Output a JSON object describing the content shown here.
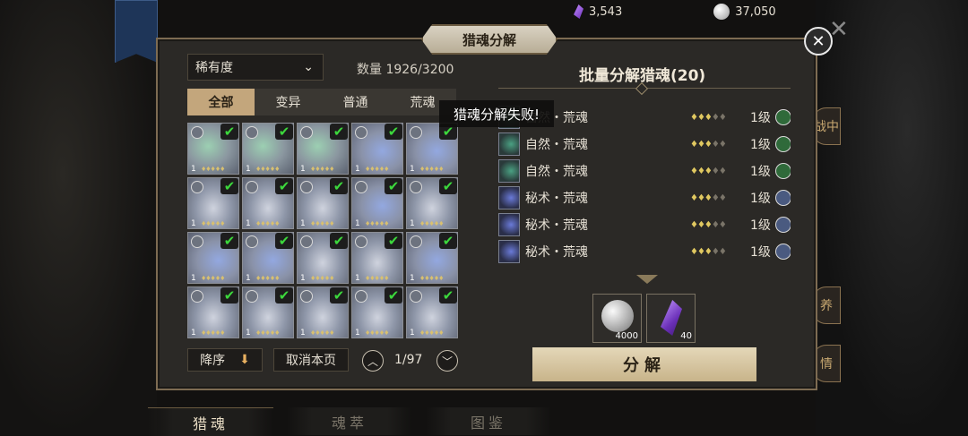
{
  "topbar": {
    "crystal_count": "3,543",
    "coin_count": "37,050",
    "crystal_icon": "purple-crystal-icon",
    "coin_icon": "silver-coin-icon"
  },
  "panel": {
    "title": "猎魂分解",
    "close": "✕"
  },
  "filter": {
    "rarity_label": "稀有度",
    "count_text": "数量 1926/3200"
  },
  "tabs": [
    {
      "label": "全部",
      "active": true
    },
    {
      "label": "变异",
      "active": false
    },
    {
      "label": "普通",
      "active": false
    },
    {
      "label": "荒魂",
      "active": false
    }
  ],
  "grid": {
    "cells": [
      {
        "level": "1",
        "stars": "♦♦♦♦♦",
        "style": "green"
      },
      {
        "level": "1",
        "stars": "♦♦♦♦♦",
        "style": "green"
      },
      {
        "level": "1",
        "stars": "♦♦♦♦♦",
        "style": "green"
      },
      {
        "level": "1",
        "stars": "♦♦♦♦♦",
        "style": "blue"
      },
      {
        "level": "1",
        "stars": "♦♦♦♦♦",
        "style": "blue"
      },
      {
        "level": "1",
        "stars": "♦♦♦♦♦",
        "style": "plain"
      },
      {
        "level": "1",
        "stars": "♦♦♦♦♦",
        "style": "plain"
      },
      {
        "level": "1",
        "stars": "♦♦♦♦♦",
        "style": "plain"
      },
      {
        "level": "1",
        "stars": "♦♦♦♦♦",
        "style": "blue"
      },
      {
        "level": "1",
        "stars": "♦♦♦♦♦",
        "style": "plain"
      },
      {
        "level": "1",
        "stars": "♦♦♦♦♦",
        "style": "blue"
      },
      {
        "level": "1",
        "stars": "♦♦♦♦♦",
        "style": "blue"
      },
      {
        "level": "1",
        "stars": "♦♦♦♦♦",
        "style": "plain"
      },
      {
        "level": "1",
        "stars": "♦♦♦♦♦",
        "style": "plain"
      },
      {
        "level": "1",
        "stars": "♦♦♦♦♦",
        "style": "blue"
      },
      {
        "level": "1",
        "stars": "♦♦♦♦♦",
        "style": "plain"
      },
      {
        "level": "1",
        "stars": "♦♦♦♦♦",
        "style": "plain"
      },
      {
        "level": "1",
        "stars": "♦♦♦♦♦",
        "style": "plain"
      },
      {
        "level": "1",
        "stars": "♦♦♦♦♦",
        "style": "plain"
      },
      {
        "level": "1",
        "stars": "♦♦♦♦♦",
        "style": "plain"
      }
    ],
    "checkmark": "✔"
  },
  "pager": {
    "sort_label": "降序",
    "sort_arrow": "⬇",
    "cancel_page_label": "取消本页",
    "prev": "︿",
    "next": "﹀",
    "page_text": "1/97"
  },
  "batch": {
    "title": "批量分解猎魂(20)",
    "rows": [
      {
        "name": "自然・荒魂",
        "level": "1级",
        "style": "green"
      },
      {
        "name": "自然・荒魂",
        "level": "1级",
        "style": "green"
      },
      {
        "name": "自然・荒魂",
        "level": "1级",
        "style": "green"
      },
      {
        "name": "秘术・荒魂",
        "level": "1级",
        "style": "blue"
      },
      {
        "name": "秘术・荒魂",
        "level": "1级",
        "style": "blue"
      },
      {
        "name": "秘术・荒魂",
        "level": "1级",
        "style": "blue"
      }
    ],
    "stars_on": "♦♦♦",
    "stars_off": "♦♦"
  },
  "toast": "猎魂分解失败!",
  "rewards": [
    {
      "icon": "silver-coin-icon",
      "count": "4000"
    },
    {
      "icon": "purple-crystal-icon",
      "count": "40"
    }
  ],
  "decompose_label": "分解",
  "side_tabs": [
    "战中",
    "养",
    "情"
  ],
  "bottom_tabs": [
    {
      "label": "猎魂",
      "active": true
    },
    {
      "label": "魂萃",
      "active": false
    },
    {
      "label": "图鉴",
      "active": false
    }
  ]
}
